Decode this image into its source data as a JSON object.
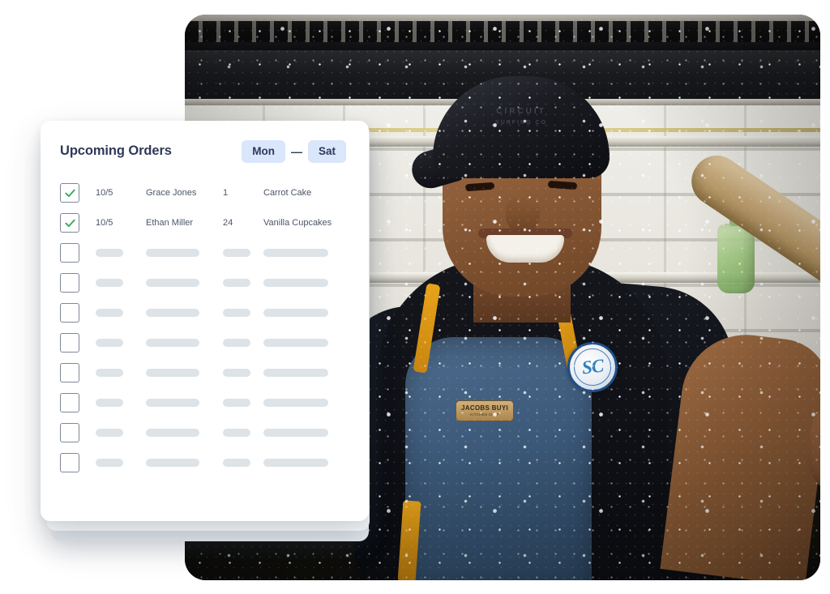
{
  "card": {
    "title": "Upcoming Orders",
    "range": {
      "start_label": "Mon",
      "separator": "—",
      "end_label": "Sat"
    },
    "columns": [
      "date",
      "customer",
      "quantity",
      "item"
    ],
    "rows": [
      {
        "checked": true,
        "date": "10/5",
        "customer": "Grace Jones",
        "quantity": "1",
        "item": "Carrot Cake"
      },
      {
        "checked": true,
        "date": "10/5",
        "customer": "Ethan Miller",
        "quantity": "24",
        "item": "Vanilla Cupcakes"
      },
      {
        "checked": false,
        "placeholder": true
      },
      {
        "checked": false,
        "placeholder": true
      },
      {
        "checked": false,
        "placeholder": true
      },
      {
        "checked": false,
        "placeholder": true
      },
      {
        "checked": false,
        "placeholder": true
      },
      {
        "checked": false,
        "placeholder": true
      },
      {
        "checked": false,
        "placeholder": true
      },
      {
        "checked": false,
        "placeholder": true
      }
    ]
  },
  "photo": {
    "scene": "smiling baker in black cap and denim apron holding a rolling pin in a flour-dusted bakery kitchen",
    "name_tag_line1": "JACOBS BUYI",
    "name_tag_line2": "KITCHEN CHEF",
    "badge_monogram": "SC",
    "cap_text_line1": "CIRCUIT",
    "cap_text_line2": "SURFING CO"
  },
  "colors": {
    "accent_pill_bg": "#d9e6fb",
    "accent_pill_text": "#2e3a59",
    "check_green": "#3aa860",
    "skeleton": "#dde3e7",
    "card_bg": "#ffffff",
    "page_bg": "#ffffff",
    "checkbox_border": "#7e8799"
  }
}
